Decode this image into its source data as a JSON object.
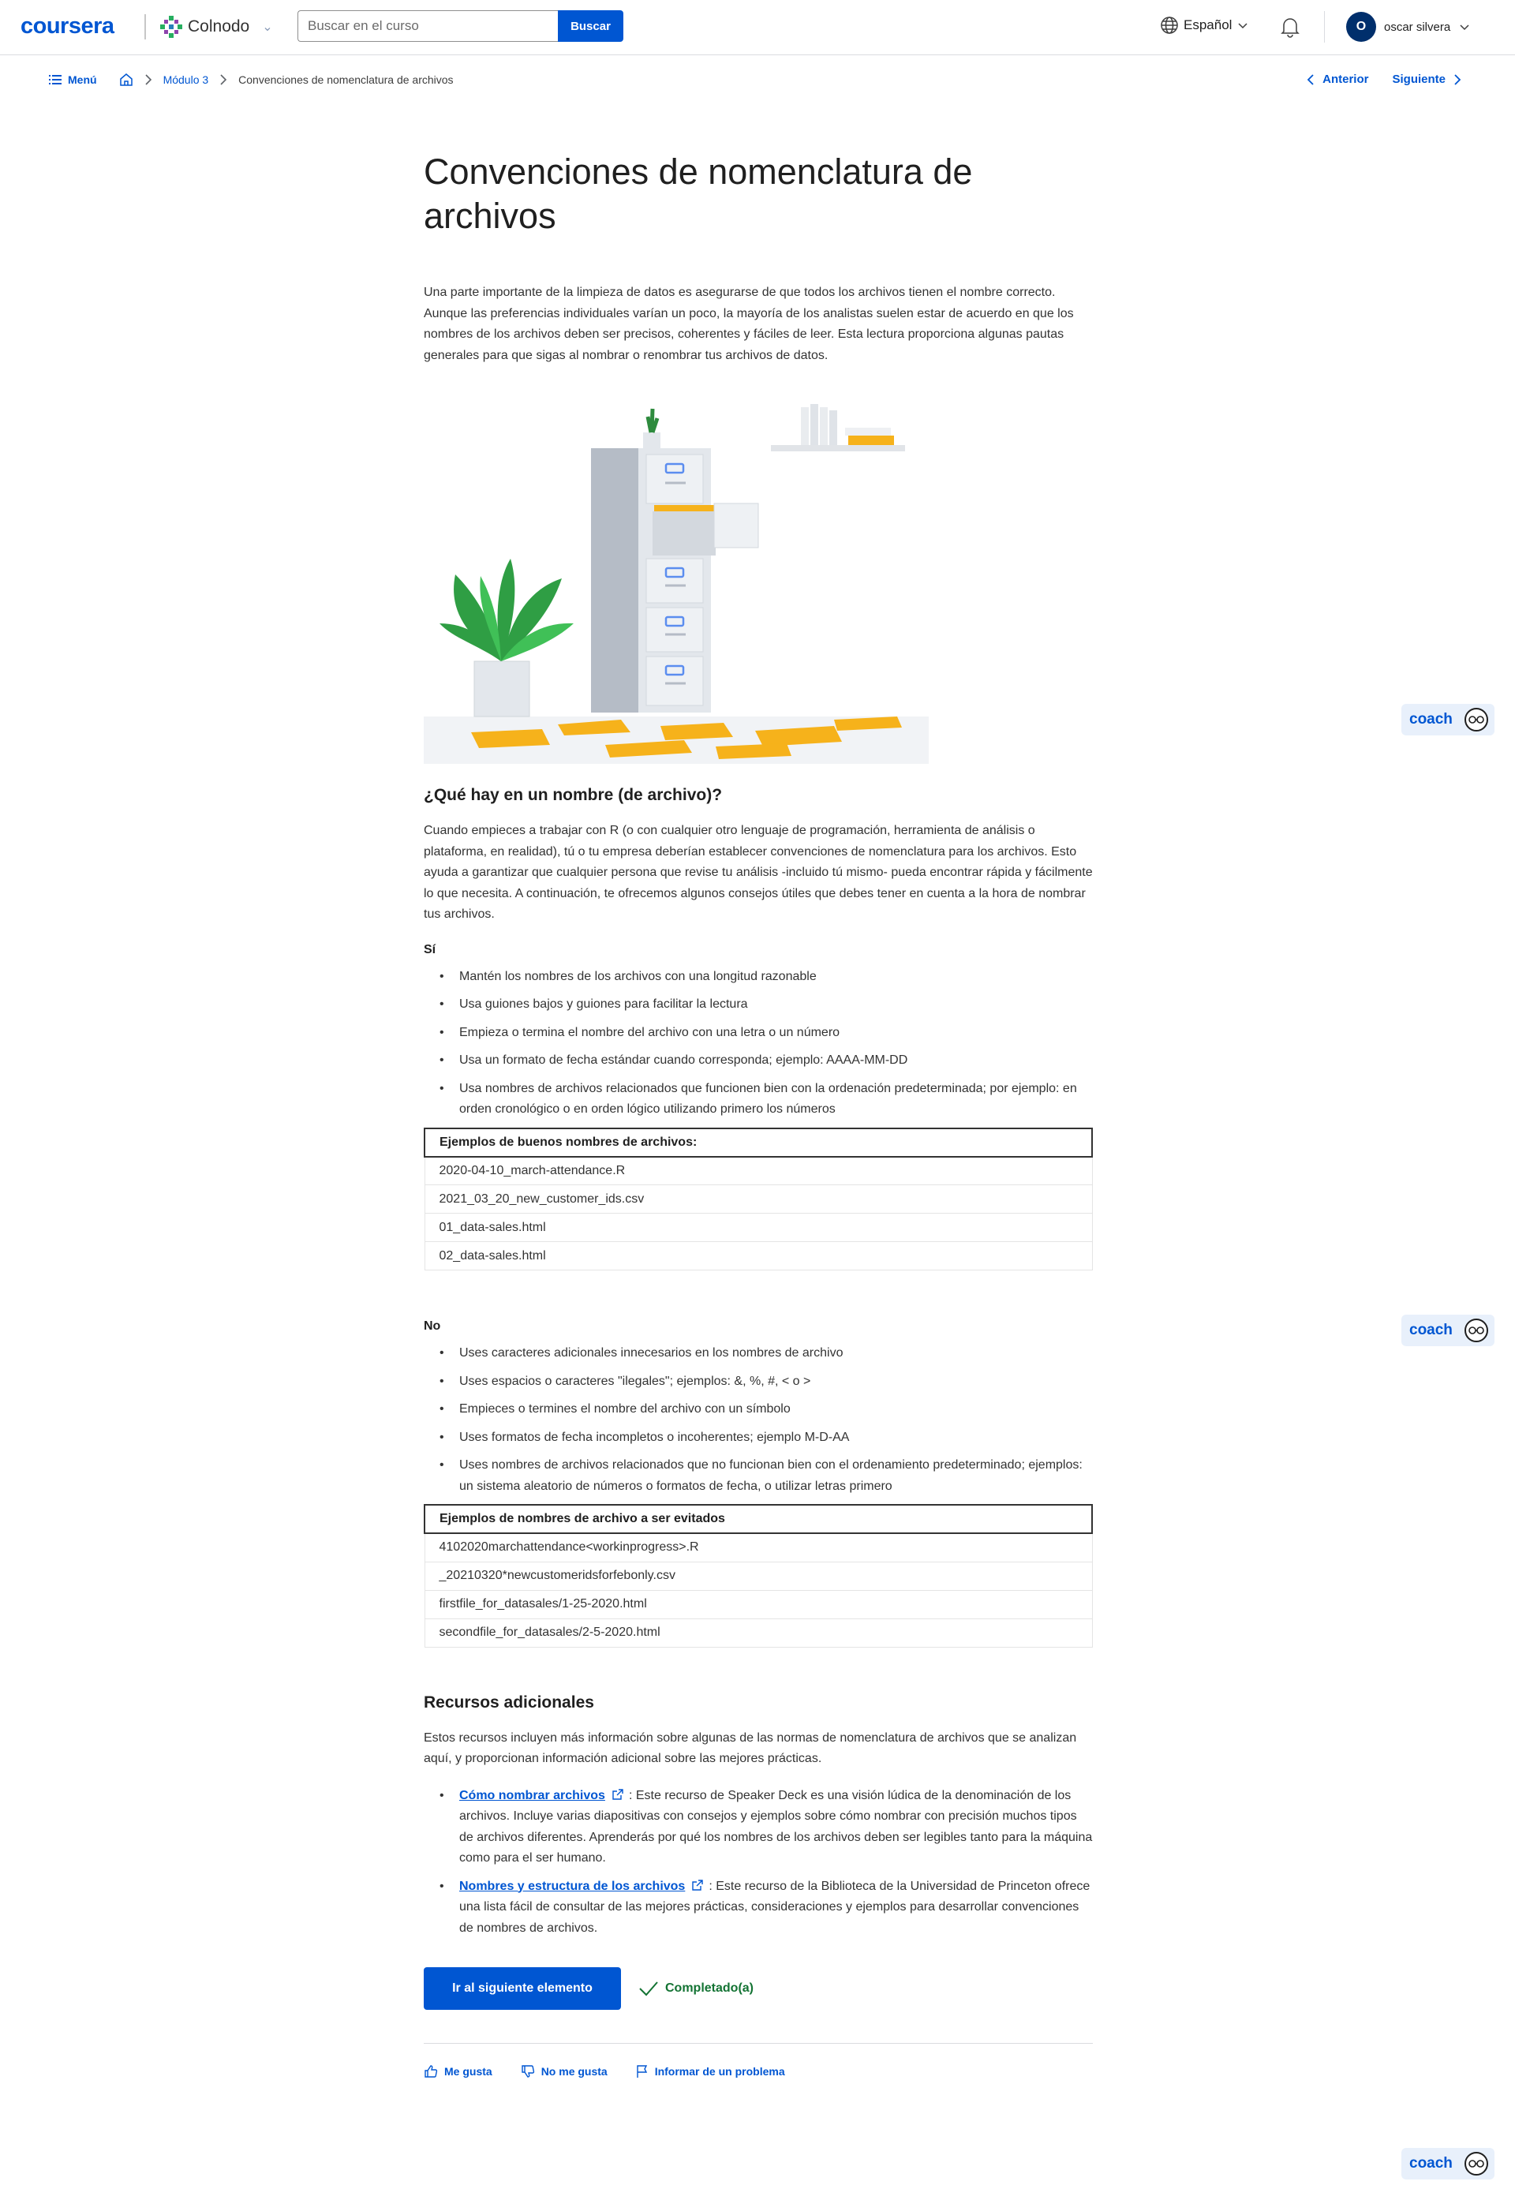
{
  "header": {
    "brand": "coursera",
    "partner": "Colnodo",
    "search_placeholder": "Buscar en el curso",
    "search_button": "Buscar",
    "language": "Español",
    "user_initial": "O",
    "user_name": "oscar silvera"
  },
  "breadcrumb": {
    "menu": "Menú",
    "module": "Módulo 3",
    "current": "Convenciones de nomenclatura de archivos",
    "prev": "Anterior",
    "next": "Siguiente"
  },
  "article": {
    "title": "Convenciones de nomenclatura de archivos",
    "intro": "Una parte importante de la limpieza de datos es asegurarse de que todos los archivos tienen el nombre correcto. Aunque las preferencias individuales varían un poco, la mayoría de los analistas suelen estar de acuerdo en que los nombres de los archivos deben ser precisos, coherentes y fáciles de leer. Esta lectura proporciona algunas pautas generales para que sigas al nombrar o renombrar tus archivos de datos.",
    "section_heading": "¿Qué hay en un nombre (de archivo)?",
    "section_text": "Cuando empieces a trabajar con R (o con cualquier otro lenguaje de programación, herramienta de análisis o plataforma, en realidad), tú o tu empresa deberían establecer convenciones de nomenclatura para los archivos. Esto ayuda a garantizar que cualquier persona que revise tu análisis -incluido tú mismo- pueda encontrar rápida y fácilmente lo que necesita. A continuación, te ofrecemos algunos consejos útiles que debes tener en cuenta a la hora de nombrar tus archivos.",
    "do_label": "Sí",
    "do_items": [
      "Mantén los nombres de los archivos con una longitud razonable",
      "Usa guiones bajos y guiones para facilitar la lectura",
      "Empieza o termina el nombre del archivo con una letra o un número",
      "Usa un formato de fecha estándar cuando corresponda; ejemplo: AAAA-MM-DD",
      "Usa nombres de archivos relacionados que funcionen bien con la ordenación predeterminada; por ejemplo: en orden cronológico o en orden lógico utilizando primero los números"
    ],
    "good_table_header": "Ejemplos de buenos nombres de archivos:",
    "good_examples": [
      "2020-04-10_march-attendance.R",
      "2021_03_20_new_customer_ids.csv",
      "01_data-sales.html",
      "02_data-sales.html"
    ],
    "dont_label": "No",
    "dont_items": [
      "Uses caracteres adicionales innecesarios en los nombres de archivo",
      "Uses espacios o caracteres \"ilegales\"; ejemplos: &, %, #, < o >",
      "Empieces o termines el nombre del archivo con un símbolo",
      "Uses formatos de fecha incompletos o incoherentes; ejemplo M-D-AA",
      "Uses nombres de archivos relacionados que no funcionan bien con el ordenamiento predeterminado; ejemplos: un sistema aleatorio de números o formatos de fecha, o utilizar letras primero"
    ],
    "bad_table_header": "Ejemplos de nombres de archivo a ser evitados",
    "bad_examples": [
      "4102020marchattendance<workinprogress>.R",
      "_20210320*newcustomeridsforfebonly.csv",
      "firstfile_for_datasales/1-25-2020.html",
      "secondfile_for_datasales/2-5-2020.html"
    ],
    "resources_heading": "Recursos adicionales",
    "resources_intro": "Estos recursos incluyen más información sobre algunas de las normas de nomenclatura de archivos que se analizan aquí, y proporcionan información adicional sobre las mejores prácticas.",
    "resources": [
      {
        "link": "Cómo nombrar archivos",
        "text": ": Este recurso de Speaker Deck es una visión lúdica de la denominación de los archivos. Incluye varias diapositivas con consejos y ejemplos sobre cómo nombrar con precisión muchos tipos de archivos diferentes. Aprenderás por qué los nombres de los archivos deben ser legibles tanto para la máquina como para el ser humano."
      },
      {
        "link": "Nombres y estructura de los archivos",
        "text": ": Este recurso de la Biblioteca de la Universidad de Princeton ofrece una lista fácil de consultar de las mejores prácticas, consideraciones y ejemplos para desarrollar convenciones de nombres de archivos."
      }
    ],
    "next_button": "Ir al siguiente elemento",
    "completed": "Completado(a)",
    "like": "Me gusta",
    "dislike": "No me gusta",
    "report": "Informar de un problema"
  },
  "coach": {
    "label": "coach"
  }
}
